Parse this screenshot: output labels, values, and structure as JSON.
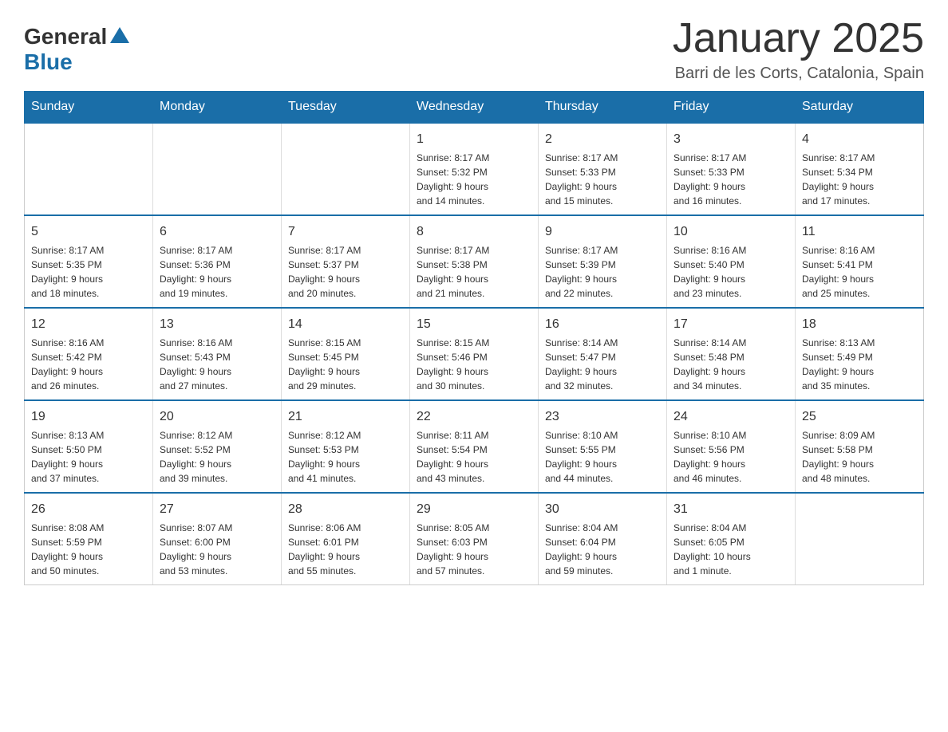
{
  "header": {
    "logo": {
      "general": "General",
      "blue": "Blue"
    },
    "title": "January 2025",
    "subtitle": "Barri de les Corts, Catalonia, Spain"
  },
  "calendar": {
    "weekdays": [
      "Sunday",
      "Monday",
      "Tuesday",
      "Wednesday",
      "Thursday",
      "Friday",
      "Saturday"
    ],
    "weeks": [
      [
        {
          "day": "",
          "info": ""
        },
        {
          "day": "",
          "info": ""
        },
        {
          "day": "",
          "info": ""
        },
        {
          "day": "1",
          "info": "Sunrise: 8:17 AM\nSunset: 5:32 PM\nDaylight: 9 hours\nand 14 minutes."
        },
        {
          "day": "2",
          "info": "Sunrise: 8:17 AM\nSunset: 5:33 PM\nDaylight: 9 hours\nand 15 minutes."
        },
        {
          "day": "3",
          "info": "Sunrise: 8:17 AM\nSunset: 5:33 PM\nDaylight: 9 hours\nand 16 minutes."
        },
        {
          "day": "4",
          "info": "Sunrise: 8:17 AM\nSunset: 5:34 PM\nDaylight: 9 hours\nand 17 minutes."
        }
      ],
      [
        {
          "day": "5",
          "info": "Sunrise: 8:17 AM\nSunset: 5:35 PM\nDaylight: 9 hours\nand 18 minutes."
        },
        {
          "day": "6",
          "info": "Sunrise: 8:17 AM\nSunset: 5:36 PM\nDaylight: 9 hours\nand 19 minutes."
        },
        {
          "day": "7",
          "info": "Sunrise: 8:17 AM\nSunset: 5:37 PM\nDaylight: 9 hours\nand 20 minutes."
        },
        {
          "day": "8",
          "info": "Sunrise: 8:17 AM\nSunset: 5:38 PM\nDaylight: 9 hours\nand 21 minutes."
        },
        {
          "day": "9",
          "info": "Sunrise: 8:17 AM\nSunset: 5:39 PM\nDaylight: 9 hours\nand 22 minutes."
        },
        {
          "day": "10",
          "info": "Sunrise: 8:16 AM\nSunset: 5:40 PM\nDaylight: 9 hours\nand 23 minutes."
        },
        {
          "day": "11",
          "info": "Sunrise: 8:16 AM\nSunset: 5:41 PM\nDaylight: 9 hours\nand 25 minutes."
        }
      ],
      [
        {
          "day": "12",
          "info": "Sunrise: 8:16 AM\nSunset: 5:42 PM\nDaylight: 9 hours\nand 26 minutes."
        },
        {
          "day": "13",
          "info": "Sunrise: 8:16 AM\nSunset: 5:43 PM\nDaylight: 9 hours\nand 27 minutes."
        },
        {
          "day": "14",
          "info": "Sunrise: 8:15 AM\nSunset: 5:45 PM\nDaylight: 9 hours\nand 29 minutes."
        },
        {
          "day": "15",
          "info": "Sunrise: 8:15 AM\nSunset: 5:46 PM\nDaylight: 9 hours\nand 30 minutes."
        },
        {
          "day": "16",
          "info": "Sunrise: 8:14 AM\nSunset: 5:47 PM\nDaylight: 9 hours\nand 32 minutes."
        },
        {
          "day": "17",
          "info": "Sunrise: 8:14 AM\nSunset: 5:48 PM\nDaylight: 9 hours\nand 34 minutes."
        },
        {
          "day": "18",
          "info": "Sunrise: 8:13 AM\nSunset: 5:49 PM\nDaylight: 9 hours\nand 35 minutes."
        }
      ],
      [
        {
          "day": "19",
          "info": "Sunrise: 8:13 AM\nSunset: 5:50 PM\nDaylight: 9 hours\nand 37 minutes."
        },
        {
          "day": "20",
          "info": "Sunrise: 8:12 AM\nSunset: 5:52 PM\nDaylight: 9 hours\nand 39 minutes."
        },
        {
          "day": "21",
          "info": "Sunrise: 8:12 AM\nSunset: 5:53 PM\nDaylight: 9 hours\nand 41 minutes."
        },
        {
          "day": "22",
          "info": "Sunrise: 8:11 AM\nSunset: 5:54 PM\nDaylight: 9 hours\nand 43 minutes."
        },
        {
          "day": "23",
          "info": "Sunrise: 8:10 AM\nSunset: 5:55 PM\nDaylight: 9 hours\nand 44 minutes."
        },
        {
          "day": "24",
          "info": "Sunrise: 8:10 AM\nSunset: 5:56 PM\nDaylight: 9 hours\nand 46 minutes."
        },
        {
          "day": "25",
          "info": "Sunrise: 8:09 AM\nSunset: 5:58 PM\nDaylight: 9 hours\nand 48 minutes."
        }
      ],
      [
        {
          "day": "26",
          "info": "Sunrise: 8:08 AM\nSunset: 5:59 PM\nDaylight: 9 hours\nand 50 minutes."
        },
        {
          "day": "27",
          "info": "Sunrise: 8:07 AM\nSunset: 6:00 PM\nDaylight: 9 hours\nand 53 minutes."
        },
        {
          "day": "28",
          "info": "Sunrise: 8:06 AM\nSunset: 6:01 PM\nDaylight: 9 hours\nand 55 minutes."
        },
        {
          "day": "29",
          "info": "Sunrise: 8:05 AM\nSunset: 6:03 PM\nDaylight: 9 hours\nand 57 minutes."
        },
        {
          "day": "30",
          "info": "Sunrise: 8:04 AM\nSunset: 6:04 PM\nDaylight: 9 hours\nand 59 minutes."
        },
        {
          "day": "31",
          "info": "Sunrise: 8:04 AM\nSunset: 6:05 PM\nDaylight: 10 hours\nand 1 minute."
        },
        {
          "day": "",
          "info": ""
        }
      ]
    ]
  }
}
